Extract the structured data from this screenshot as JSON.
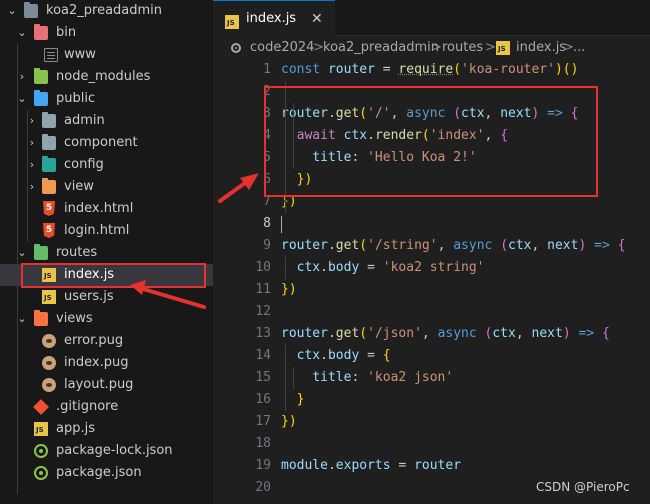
{
  "explorer": {
    "items": [
      {
        "label": "koa2_preadadmin",
        "icon": "folder-open-icon",
        "chevron": "open"
      },
      {
        "label": "bin",
        "icon": "folder-bin-icon",
        "chevron": "open"
      },
      {
        "label": "www",
        "icon": "file-icon",
        "chevron": ""
      },
      {
        "label": "node_modules",
        "icon": "folder-node-icon",
        "chevron": "closed"
      },
      {
        "label": "public",
        "icon": "folder-public-icon",
        "chevron": "open"
      },
      {
        "label": "admin",
        "icon": "folder-icon",
        "chevron": "closed"
      },
      {
        "label": "component",
        "icon": "folder-icon",
        "chevron": "closed"
      },
      {
        "label": "config",
        "icon": "folder-config-icon",
        "chevron": "closed"
      },
      {
        "label": "view",
        "icon": "folder-view-icon",
        "chevron": "closed"
      },
      {
        "label": "index.html",
        "icon": "html-file-icon",
        "chevron": ""
      },
      {
        "label": "login.html",
        "icon": "html-file-icon",
        "chevron": ""
      },
      {
        "label": "routes",
        "icon": "folder-routes-icon",
        "chevron": "open"
      },
      {
        "label": "index.js",
        "icon": "js-file-icon",
        "chevron": ""
      },
      {
        "label": "users.js",
        "icon": "js-file-icon",
        "chevron": ""
      },
      {
        "label": "views",
        "icon": "folder-views-icon",
        "chevron": "open"
      },
      {
        "label": "error.pug",
        "icon": "pug-file-icon",
        "chevron": ""
      },
      {
        "label": "index.pug",
        "icon": "pug-file-icon",
        "chevron": ""
      },
      {
        "label": "layout.pug",
        "icon": "pug-file-icon",
        "chevron": ""
      },
      {
        "label": ".gitignore",
        "icon": "git-file-icon",
        "chevron": ""
      },
      {
        "label": "app.js",
        "icon": "js-file-icon",
        "chevron": ""
      },
      {
        "label": "package-lock.json",
        "icon": "json-file-icon",
        "chevron": ""
      },
      {
        "label": "package.json",
        "icon": "json-file-icon",
        "chevron": ""
      }
    ]
  },
  "tab": {
    "js_badge": "JS",
    "label": "index.js",
    "close": "✕"
  },
  "breadcrumb": {
    "items": [
      "code2024",
      "koa2_preadadmin",
      "routes",
      "index.js",
      "..."
    ],
    "separator": ">"
  },
  "editor": {
    "active_line": 8,
    "lines": [
      {
        "n": "1",
        "code": "const router = require('koa-router')()"
      },
      {
        "n": "2",
        "code": ""
      },
      {
        "n": "3",
        "code": "router.get('/', async (ctx, next) => {"
      },
      {
        "n": "4",
        "code": "  await ctx.render('index', {"
      },
      {
        "n": "5",
        "code": "    title: 'Hello Koa 2!'"
      },
      {
        "n": "6",
        "code": "  })"
      },
      {
        "n": "7",
        "code": "})"
      },
      {
        "n": "8",
        "code": ""
      },
      {
        "n": "9",
        "code": "router.get('/string', async (ctx, next) => {"
      },
      {
        "n": "10",
        "code": "  ctx.body = 'koa2 string'"
      },
      {
        "n": "11",
        "code": "})"
      },
      {
        "n": "12",
        "code": ""
      },
      {
        "n": "13",
        "code": "router.get('/json', async (ctx, next) => {"
      },
      {
        "n": "14",
        "code": "  ctx.body = {"
      },
      {
        "n": "15",
        "code": "    title: 'koa2 json'"
      },
      {
        "n": "16",
        "code": "  }"
      },
      {
        "n": "17",
        "code": "})"
      },
      {
        "n": "18",
        "code": ""
      },
      {
        "n": "19",
        "code": "module.exports = router"
      },
      {
        "n": "20",
        "code": ""
      }
    ]
  },
  "colors": {
    "annotation_red": "#e5312f",
    "keyword": "#569cd6",
    "control_keyword": "#c586c0",
    "variable": "#9cdcfe",
    "function": "#dcdcaa",
    "string": "#ce9178"
  },
  "watermark": "CSDN @PieroPc"
}
